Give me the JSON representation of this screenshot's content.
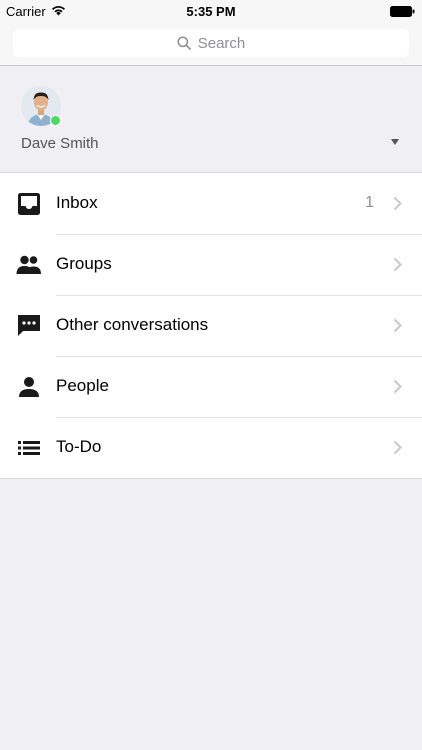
{
  "status_bar": {
    "carrier": "Carrier",
    "time": "5:35 PM",
    "icons": [
      "wifi-icon",
      "battery-icon"
    ]
  },
  "search": {
    "placeholder": "Search",
    "icon": "search-icon"
  },
  "profile": {
    "name": "Dave Smith",
    "presence": "online",
    "presence_color": "#4cd964",
    "dropdown_icon": "triangle-down-icon"
  },
  "menu": {
    "items": [
      {
        "label": "Inbox",
        "icon": "inbox-icon",
        "badge": "1"
      },
      {
        "label": "Groups",
        "icon": "groups-icon",
        "badge": ""
      },
      {
        "label": "Other conversations",
        "icon": "chat-bubble-icon",
        "badge": ""
      },
      {
        "label": "People",
        "icon": "person-icon",
        "badge": ""
      },
      {
        "label": "To-Do",
        "icon": "list-icon",
        "badge": ""
      }
    ]
  },
  "colors": {
    "background": "#efeff4",
    "list_background": "#ffffff",
    "secondary_text": "#8e8e93"
  }
}
